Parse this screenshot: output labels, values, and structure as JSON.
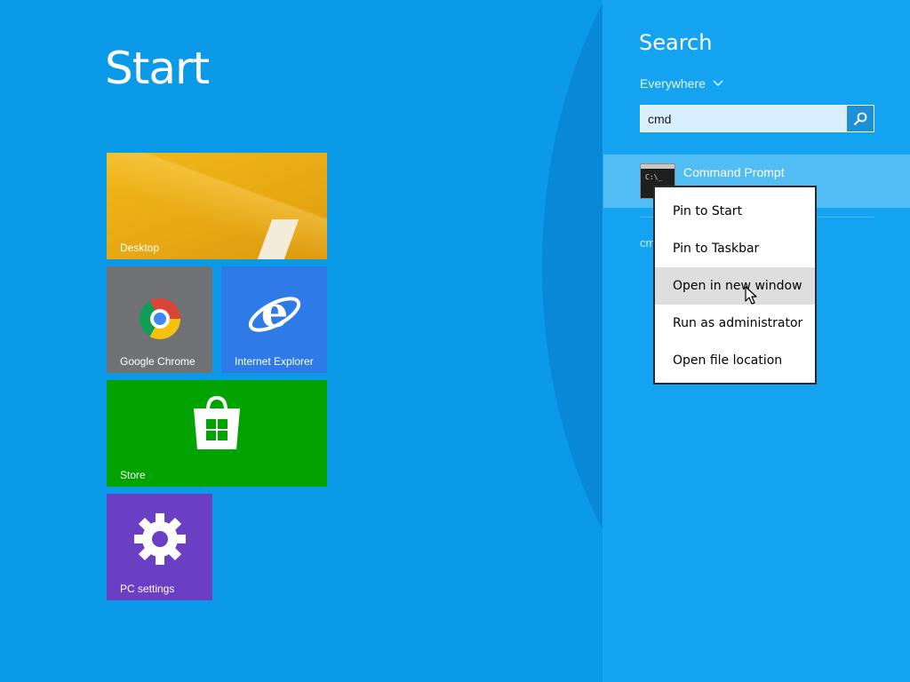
{
  "start": {
    "title": "Start",
    "tiles": [
      {
        "label": "Desktop",
        "color": "#e7a813"
      },
      {
        "label": "Google Chrome",
        "color": "#707276"
      },
      {
        "label": "Internet Explorer",
        "color": "#2e7ae6"
      },
      {
        "label": "Store",
        "color": "#00a300"
      },
      {
        "label": "PC settings",
        "color": "#6a3fc3"
      }
    ]
  },
  "search": {
    "title": "Search",
    "scope": "Everywhere",
    "query": "cmd",
    "result": {
      "title": "Command Prompt",
      "icon": "command-prompt-icon"
    },
    "partial_text": "cm"
  },
  "context_menu": {
    "items": [
      {
        "label": "Pin to Start"
      },
      {
        "label": "Pin to Taskbar"
      },
      {
        "label": "Open in new window",
        "highlighted": true
      },
      {
        "label": "Run as administrator"
      },
      {
        "label": "Open file location"
      }
    ]
  },
  "colors": {
    "background": "#0a9ae8",
    "search_pane": "#14a3f0",
    "result_highlight": "#52bdf5"
  },
  "icons": [
    "chrome-icon",
    "internet-explorer-icon",
    "store-icon",
    "gear-icon",
    "search-icon",
    "chevron-down-icon",
    "command-prompt-icon",
    "mouse-cursor-icon"
  ]
}
